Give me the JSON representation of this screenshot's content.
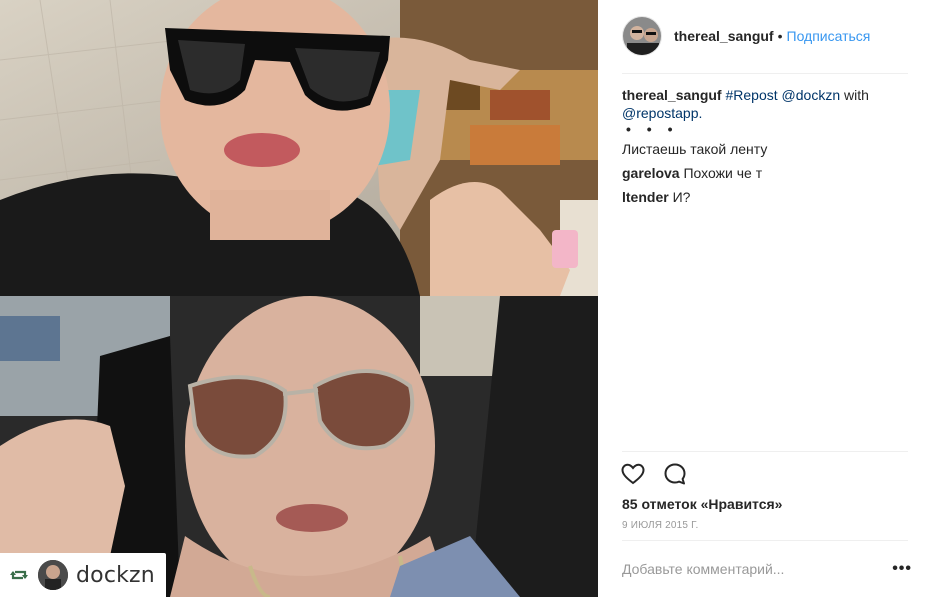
{
  "post": {
    "username": "thereal_sanguf",
    "separator": "•",
    "follow_label": "Подписаться",
    "media_description": [],
    "repost_badge": {
      "username": "dockzn"
    }
  },
  "comments": [
    {
      "user": "thereal_sanguf",
      "parts": [
        "#Repost",
        "@dockzn",
        "with",
        "@repostapp."
      ],
      "ellipsis": "• • •",
      "text_line": "Листаешь такой ленту"
    },
    {
      "user": "garelova",
      "text": "Похожи че т"
    },
    {
      "user": "ltender",
      "text": "И?"
    }
  ],
  "stats": {
    "likes_label": "85 отметок «Нравится»",
    "date_label": "9 ИЮЛЯ 2015 Г."
  },
  "comment_box": {
    "placeholder": "Добавьте комментарий...",
    "more_label": "•••"
  },
  "colors": {
    "link_blue": "#3897f0",
    "hashtag_navy": "#003569",
    "muted_gray": "#999999",
    "divider": "#efefef"
  },
  "icons": [
    "heart-icon",
    "comment-icon",
    "repost-icon",
    "more-options-icon"
  ]
}
